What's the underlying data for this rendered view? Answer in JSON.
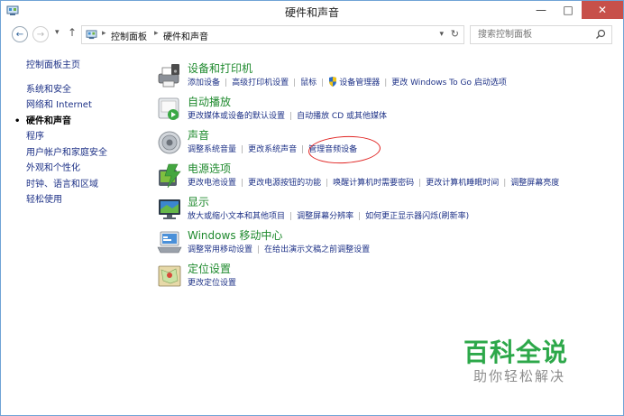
{
  "window": {
    "title": "硬件和声音",
    "minimize": "—",
    "maximize": "□",
    "close": "✕"
  },
  "nav": {
    "back": "←",
    "forward": "→",
    "recent": "▾",
    "up": "↑",
    "breadcrumb": [
      "控制面板",
      "硬件和声音"
    ],
    "breadcrumb_sep": "▸",
    "dropdown": "▾",
    "refresh": "↻"
  },
  "search": {
    "placeholder": "搜索控制面板"
  },
  "sidebar": {
    "items": [
      {
        "label": "控制面板主页"
      },
      {
        "label": "系统和安全"
      },
      {
        "label": "网络和 Internet"
      },
      {
        "label": "硬件和声音"
      },
      {
        "label": "程序"
      },
      {
        "label": "用户帐户和家庭安全"
      },
      {
        "label": "外观和个性化"
      },
      {
        "label": "时钟、语言和区域"
      },
      {
        "label": "轻松使用"
      }
    ],
    "active_marker": "•"
  },
  "categories": [
    {
      "title": "设备和打印机",
      "icon": "printer-icon",
      "links": [
        "添加设备",
        "高级打印机设置",
        "鼠标",
        "设备管理器",
        "更改 Windows To Go 启动选项"
      ]
    },
    {
      "title": "自动播放",
      "icon": "autoplay-icon",
      "links": [
        "更改媒体或设备的默认设置",
        "自动播放 CD 或其他媒体"
      ]
    },
    {
      "title": "声音",
      "icon": "speaker-icon",
      "links": [
        "调整系统音量",
        "更改系统声音",
        "管理音频设备"
      ]
    },
    {
      "title": "电源选项",
      "icon": "power-icon",
      "links": [
        "更改电池设置",
        "更改电源按钮的功能",
        "唤醒计算机时需要密码",
        "更改计算机睡眠时间",
        "调整屏幕亮度"
      ]
    },
    {
      "title": "显示",
      "icon": "monitor-icon",
      "links": [
        "放大或缩小文本和其他项目",
        "调整屏幕分辨率",
        "如何更正显示器闪烁(刷新率)"
      ]
    },
    {
      "title": "Windows 移动中心",
      "icon": "mobility-center-icon",
      "links": [
        "调整常用移动设置",
        "在给出演示文稿之前调整设置"
      ]
    },
    {
      "title": "定位设置",
      "icon": "location-icon",
      "links": [
        "更改定位设置"
      ]
    }
  ],
  "link_separator": "|",
  "watermark": {
    "title": "百科全说",
    "subtitle": "助你轻松解决"
  },
  "colors": {
    "category_title": "#1f8a2e",
    "link": "#1e3287",
    "annotation": "#e0211f",
    "watermark": "#2da84a"
  }
}
